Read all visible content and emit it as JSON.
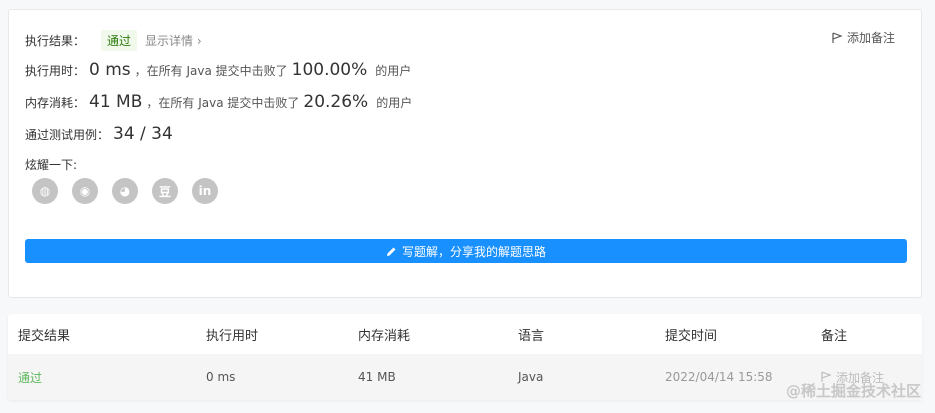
{
  "result": {
    "label": "执行结果：",
    "status": "通过",
    "details": "显示详情 ›",
    "add_note": "添加备注",
    "runtime": {
      "label": "执行用时：",
      "value": "0 ms",
      "mid": "，在所有 Java 提交中击败了",
      "percent": "100.00%",
      "suffix": "的用户"
    },
    "memory": {
      "label": "内存消耗：",
      "value": "41 MB",
      "mid": "，在所有 Java 提交中击败了",
      "percent": "20.26%",
      "suffix": "的用户"
    },
    "tests": {
      "label": "通过测试用例：",
      "value": "34 / 34"
    },
    "share_label": "炫耀一下:",
    "share_icons": [
      "wechat-icon",
      "weibo-icon",
      "qq-icon",
      "douban-icon",
      "linkedin-icon"
    ],
    "share_glyphs": [
      "◍",
      "◉",
      "◕",
      "豆",
      "in"
    ],
    "write_solution": "写题解，分享我的解题思路"
  },
  "submissions": {
    "headers": [
      "提交结果",
      "执行用时",
      "内存消耗",
      "语言",
      "提交时间",
      "备注"
    ],
    "rows": [
      {
        "status": "通过",
        "runtime": "0 ms",
        "memory": "41 MB",
        "language": "Java",
        "time": "2022/04/14 15:58",
        "note": "添加备注"
      }
    ]
  },
  "watermark": "@稀土掘金技术社区",
  "colors": {
    "primary": "#1890ff",
    "success": "#5cb85c",
    "badge_bg": "#f0f9eb"
  }
}
